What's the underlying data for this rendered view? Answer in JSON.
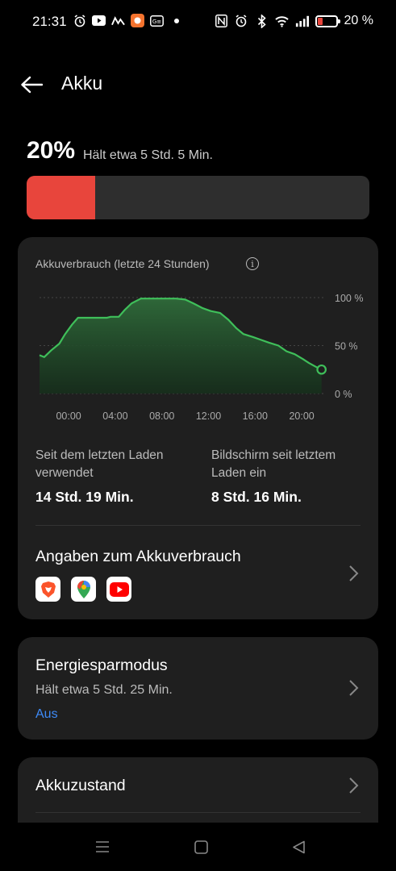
{
  "status_bar": {
    "time": "21:31",
    "battery_text": "20 %",
    "left_icons": [
      "alarm-icon",
      "youtube-icon",
      "maps-icon",
      "app-notification-icon",
      "gboard-icon",
      "more-dots-icon"
    ],
    "right_icons": [
      "nfc-icon",
      "alarm-icon",
      "bluetooth-icon",
      "wifi-icon",
      "signal-icon",
      "battery-icon"
    ]
  },
  "header": {
    "title": "Akku"
  },
  "battery": {
    "percent_label": "20%",
    "estimate": "Hält etwa 5 Std. 5 Min.",
    "level": 0.2,
    "fill_color": "#e8453c"
  },
  "usage_card": {
    "chart_title": "Akkuverbrauch (letzte 24 Stunden)",
    "stats": [
      {
        "label": "Seit dem letzten Laden verwendet",
        "value": "14 Std. 19 Min."
      },
      {
        "label": "Bildschirm seit letztem Laden ein",
        "value": "8 Std. 16 Min."
      }
    ],
    "details_title": "Angaben zum Akkuverbrauch",
    "apps": [
      "brave-icon",
      "google-maps-icon",
      "youtube-icon"
    ]
  },
  "chart_data": {
    "type": "area",
    "title": "Akkuverbrauch (letzte 24 Stunden)",
    "x_ticks": [
      "00:00",
      "04:00",
      "08:00",
      "12:00",
      "16:00",
      "20:00"
    ],
    "y_ticks": [
      "100 %",
      "50 %",
      "0 %"
    ],
    "ylim": [
      0,
      100
    ],
    "xlim": [
      -2.5,
      22
    ],
    "series": [
      {
        "x": [
          -2.5,
          -2.1,
          -1.5,
          -0.8,
          -0.3,
          0.3,
          0.8,
          1.6,
          2.5,
          3.3,
          3.6,
          4.3,
          4.8,
          5.4,
          6.2,
          6.8,
          7.6,
          8.4,
          9.2,
          10.0,
          10.7,
          11.5,
          12.2,
          13.0,
          13.7,
          14.4,
          15.0,
          15.8,
          16.5,
          17.2,
          18.0,
          18.7,
          19.4,
          20.1,
          20.6,
          21.2,
          21.7
        ],
        "y": [
          40,
          38,
          45,
          52,
          62,
          72,
          79,
          79,
          79,
          79,
          80,
          80,
          87,
          94,
          99,
          99,
          99,
          99,
          99,
          98,
          94,
          89,
          86,
          84,
          77,
          68,
          62,
          59,
          56,
          53,
          50,
          44,
          41,
          36,
          32,
          28,
          25
        ]
      }
    ],
    "line_color": "#3fbf5a",
    "grid": true
  },
  "power_saving": {
    "title": "Energiesparmodus",
    "subtitle": "Hält etwa 5 Std. 25 Min.",
    "status": "Aus"
  },
  "battery_health": {
    "title": "Akkuzustand"
  },
  "nav_bar": {
    "buttons": [
      "menu-icon",
      "home-icon",
      "back-icon"
    ]
  }
}
